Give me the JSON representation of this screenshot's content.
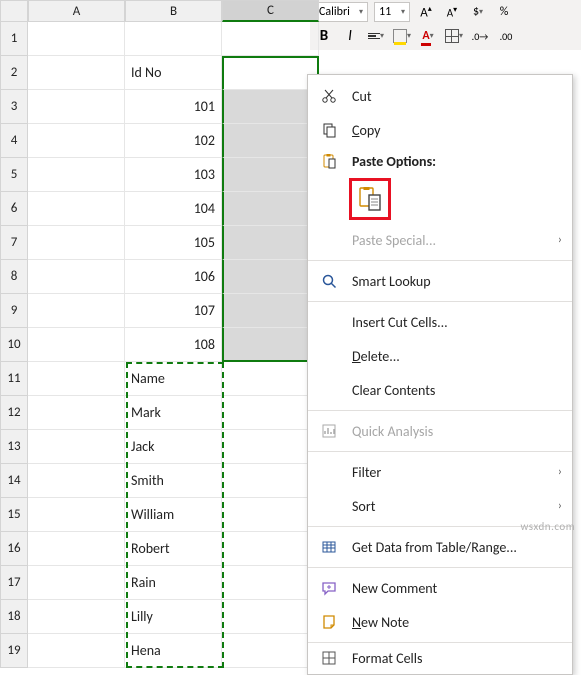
{
  "ribbon": {
    "font_name": "Calibri",
    "font_size": "11",
    "bold": "B",
    "italic": "I",
    "font_color_letter": "A",
    "currency": "$",
    "percent": "%"
  },
  "columns": [
    "A",
    "B",
    "C"
  ],
  "row_numbers": [
    "1",
    "2",
    "3",
    "4",
    "5",
    "6",
    "7",
    "8",
    "9",
    "10",
    "11",
    "12",
    "13",
    "14",
    "15",
    "16",
    "17",
    "18",
    "19"
  ],
  "sheet": {
    "header_b": "Id No",
    "ids": [
      "101",
      "102",
      "103",
      "104",
      "105",
      "106",
      "107",
      "108"
    ],
    "names_header": "Name",
    "names": [
      "Mark",
      "Jack",
      "Smith",
      "William",
      "Robert",
      "Rain",
      "Lilly",
      "Hena"
    ]
  },
  "ctx": {
    "cut": "Cut",
    "copy": "Copy",
    "paste_header": "Paste Options:",
    "paste_special": "Paste Special...",
    "smart_lookup": "Smart Lookup",
    "insert_cut": "Insert Cut Cells...",
    "delete": "Delete...",
    "clear": "Clear Contents",
    "quick_analysis": "Quick Analysis",
    "filter": "Filter",
    "sort": "Sort",
    "get_data": "Get Data from Table/Range...",
    "new_comment": "New Comment",
    "new_note": "New Note",
    "format_cells": "Format Cells"
  },
  "watermark": "wsxdn.com"
}
